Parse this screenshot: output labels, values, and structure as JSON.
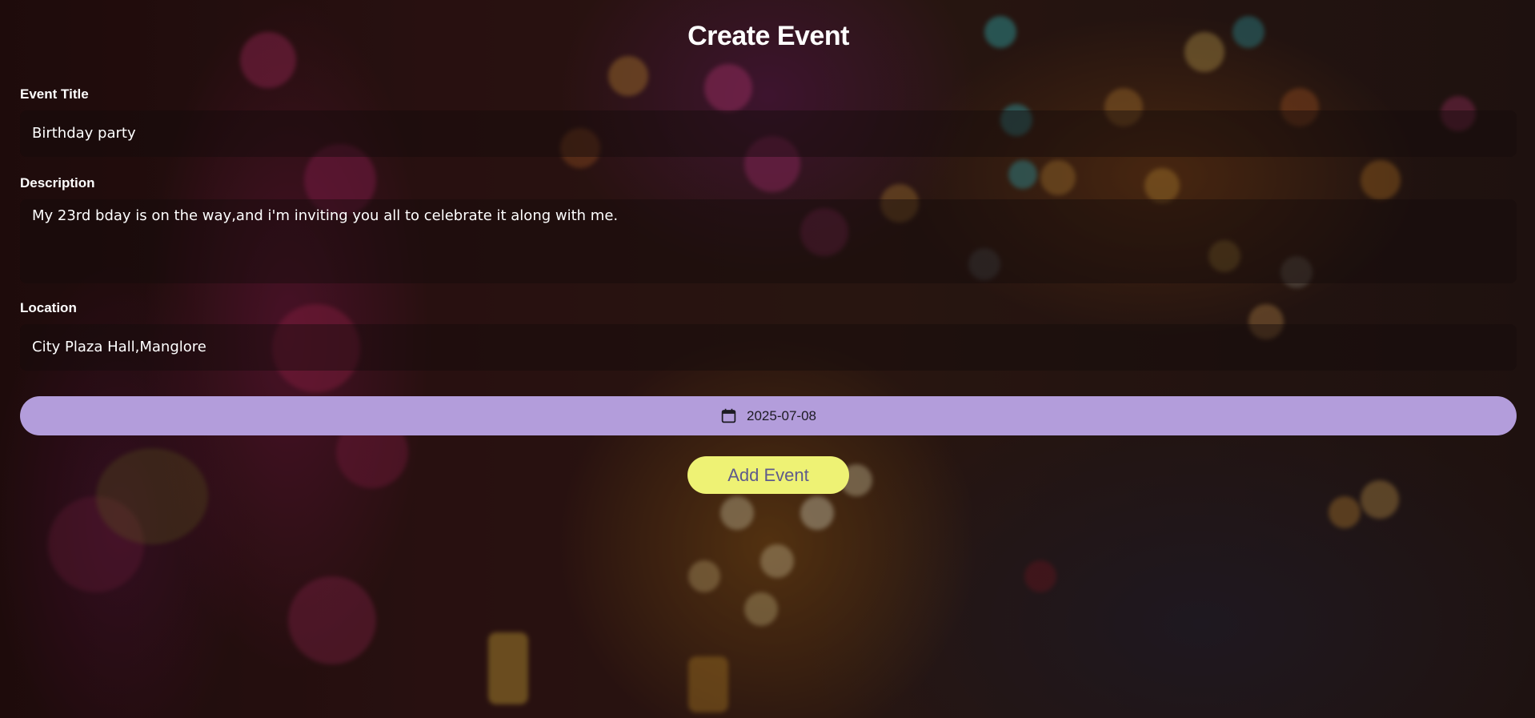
{
  "page": {
    "title": "Create Event"
  },
  "fields": {
    "title": {
      "label": "Event Title",
      "value": "Birthday party"
    },
    "description": {
      "label": "Description",
      "value": "My 23rd bday is on the way,and i'm inviting you all to celebrate it along with me."
    },
    "location": {
      "label": "Location",
      "value": "City Plaza Hall,Manglore"
    }
  },
  "date_button": {
    "icon": "calendar-icon",
    "value": "2025-07-08"
  },
  "submit_button": {
    "label": "Add Event"
  },
  "colors": {
    "date_button_bg": "#b39ddb",
    "submit_button_bg": "#eef274",
    "submit_button_text": "#5e5a8c"
  }
}
